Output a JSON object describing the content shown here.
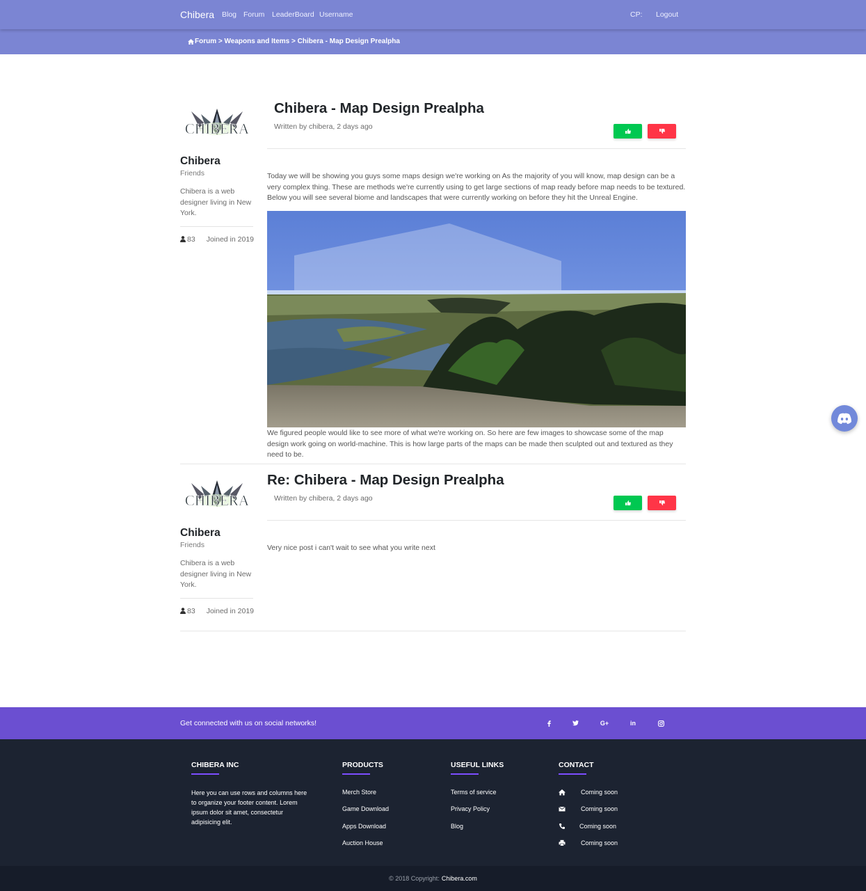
{
  "navbar": {
    "brand": "Chibera",
    "links": [
      "Blog",
      "Forum",
      "LeaderBoard",
      "Username"
    ],
    "cp_label": "CP:",
    "logout": "Logout",
    "color": "#7b85d3"
  },
  "breadcrumb": "Forum > Weapons and Items > Chibera - Map Design Prealpha",
  "posts": [
    {
      "author": {
        "avatar_text": "CHIBERA",
        "name": "Chibera",
        "role": "Friends",
        "bio": "Chibera is a web designer living in New York.",
        "count": "83",
        "joined": "Joined in 2019"
      },
      "title": "Chibera - Map Design Prealpha",
      "meta": "Written by chibera, 2 days ago",
      "body": "Today we will be showing you guys some maps design we're working on As the majority of you will know, map design can be a very complex thing. These are methods we're currently using to get large sections of map ready before map needs to be textured. Below you will see several biome and landscapes that were currently working on before they hit the Unreal Engine.",
      "body_after": "We figured people would like to see more of what we're working on. So here are few images to showcase some of the map design work going on world-machine. This is how large parts of the maps can be made then sculpted out and textured as they need to be."
    },
    {
      "author": {
        "avatar_text": "CHIBERA",
        "name": "Chibera",
        "role": "Friends",
        "bio": "Chibera is a web designer living in New York.",
        "count": "83",
        "joined": "Joined in 2019"
      },
      "title": "Re: Chibera - Map Design Prealpha",
      "meta": "Written by chibera, 2 days ago",
      "body": "Very nice post i can't wait to see what you write next"
    }
  ],
  "vote_colors": {
    "up": "#00c851",
    "down": "#ff3547"
  },
  "social": {
    "text": "Get connected with us on social networks!",
    "icons": [
      "facebook-icon",
      "twitter-icon",
      "google-plus-icon",
      "linkedin-icon",
      "instagram-icon"
    ],
    "google_glyph": "G+",
    "linkedin_glyph": "in",
    "color": "#6b4fd1"
  },
  "footer": {
    "company": {
      "heading": "CHIBERA INC",
      "text": "Here you can use rows and columns here to organize your footer content. Lorem ipsum dolor sit amet, consectetur adipisicing elit."
    },
    "products": {
      "heading": "PRODUCTS",
      "items": [
        "Merch Store",
        "Game Download",
        "Apps Download",
        "Auction House"
      ]
    },
    "useful": {
      "heading": "USEFUL LINKS",
      "items": [
        "Terms of service",
        "Privacy Policy",
        "Blog"
      ]
    },
    "contact": {
      "heading": "CONTACT",
      "items": [
        "Coming soon",
        "Coming soon",
        "Coming soon",
        "Coming soon"
      ]
    },
    "copyright_prefix": "© 2018 Copyright:",
    "copyright_link": "Chibera.com",
    "color": "#1c2331"
  }
}
